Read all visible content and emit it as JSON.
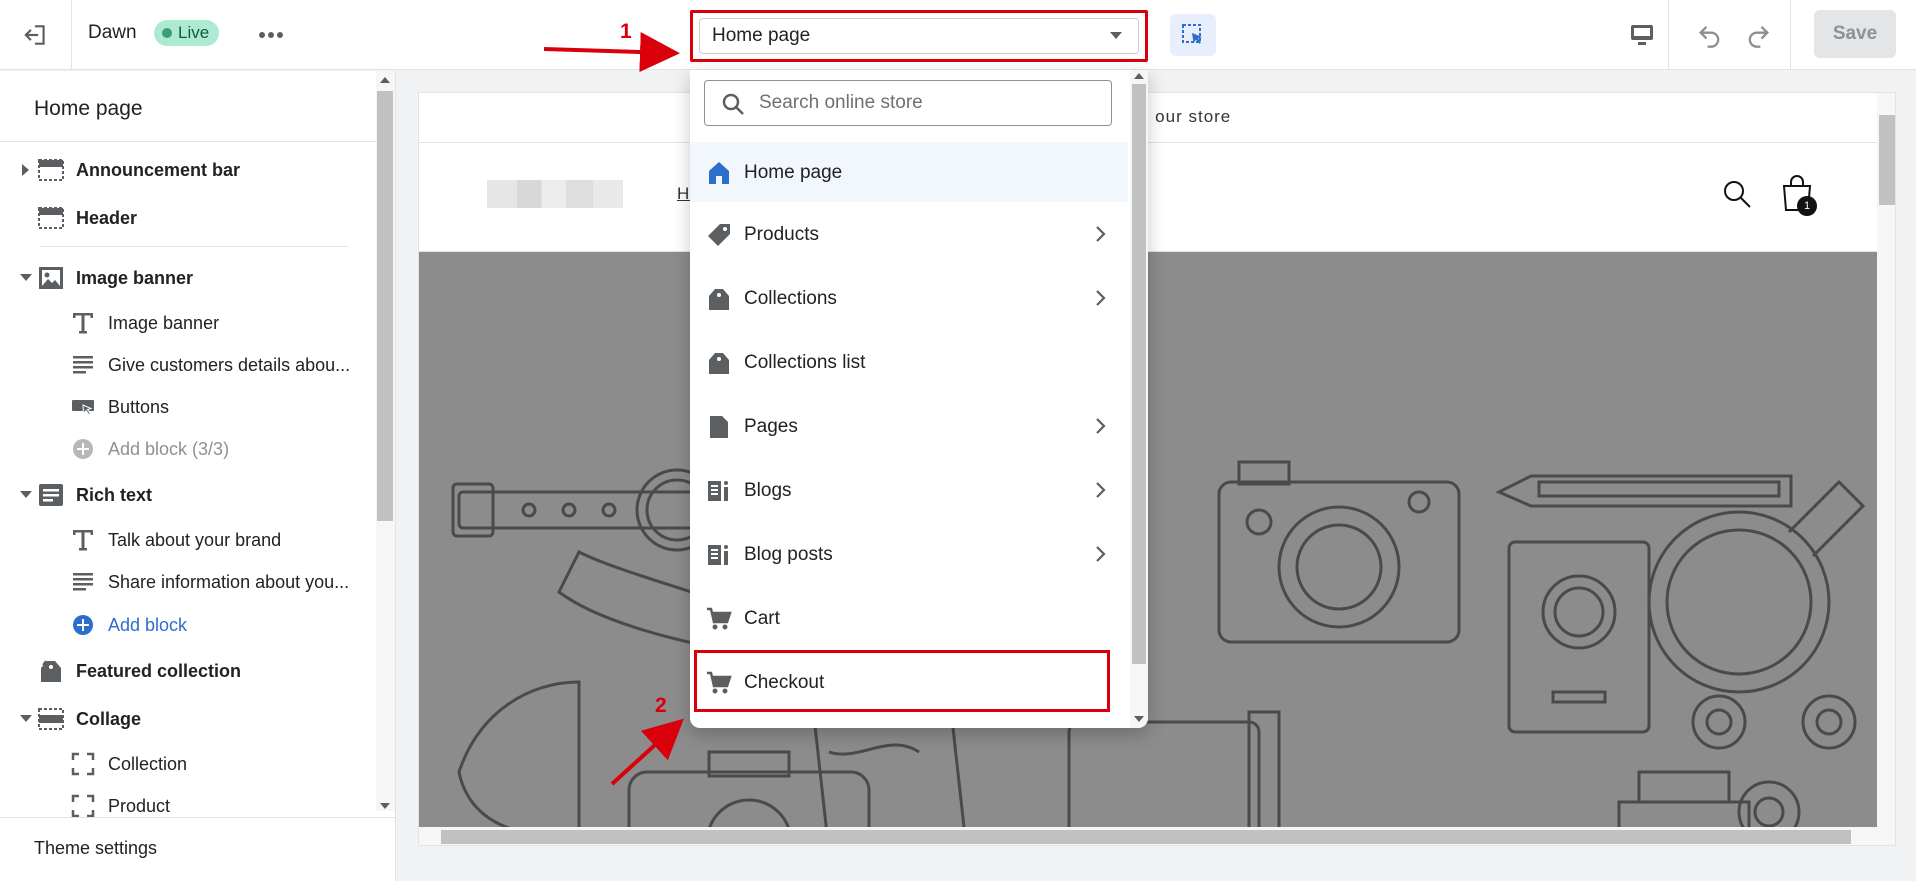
{
  "topbar": {
    "theme_name": "Dawn",
    "status_badge": "Live",
    "save_label": "Save"
  },
  "page_selector": {
    "value": "Home page"
  },
  "sidebar": {
    "title": "Home page",
    "items": [
      {
        "label": "Announcement bar",
        "icon": "layout-section-icon",
        "caret": "right"
      },
      {
        "label": "Header",
        "icon": "header-section-icon"
      },
      {
        "label": "Image banner",
        "icon": "image-icon",
        "caret": "down"
      },
      {
        "label": "Image banner",
        "icon": "text-icon"
      },
      {
        "label": "Give customers details abou...",
        "icon": "paragraph-icon"
      },
      {
        "label": "Buttons",
        "icon": "buttons-icon"
      },
      {
        "label": "Add block (3/3)",
        "icon": "add-circle-icon"
      },
      {
        "label": "Rich text",
        "icon": "rich-text-icon",
        "caret": "down"
      },
      {
        "label": "Talk about your brand",
        "icon": "text-icon"
      },
      {
        "label": "Share information about you...",
        "icon": "paragraph-icon"
      },
      {
        "label": "Add block",
        "icon": "add-circle-icon"
      },
      {
        "label": "Featured collection",
        "icon": "collection-icon"
      },
      {
        "label": "Collage",
        "icon": "collage-icon",
        "caret": "down"
      },
      {
        "label": "Collection",
        "icon": "frame-icon"
      },
      {
        "label": "Product",
        "icon": "frame-icon"
      }
    ],
    "footer_label": "Theme settings"
  },
  "preview": {
    "announcement_text": "o our store",
    "nav_link": "Ho",
    "cart_count": "1"
  },
  "dropdown": {
    "search_placeholder": "Search online store",
    "items": [
      {
        "label": "Home page",
        "icon": "home-icon",
        "active": true
      },
      {
        "label": "Products",
        "icon": "tag-icon",
        "chevron": true
      },
      {
        "label": "Collections",
        "icon": "collection-icon",
        "chevron": true
      },
      {
        "label": "Collections list",
        "icon": "collection-icon"
      },
      {
        "label": "Pages",
        "icon": "page-icon",
        "chevron": true
      },
      {
        "label": "Blogs",
        "icon": "blog-icon",
        "chevron": true
      },
      {
        "label": "Blog posts",
        "icon": "blog-icon",
        "chevron": true
      },
      {
        "label": "Cart",
        "icon": "cart-icon"
      },
      {
        "label": "Checkout",
        "icon": "cart-icon"
      }
    ]
  },
  "annotations": {
    "step1": "1",
    "step2": "2"
  },
  "colors": {
    "highlight_red": "#d9000c",
    "accent_blue": "#2c6ecb",
    "live_badge_bg": "#aee9d1"
  }
}
